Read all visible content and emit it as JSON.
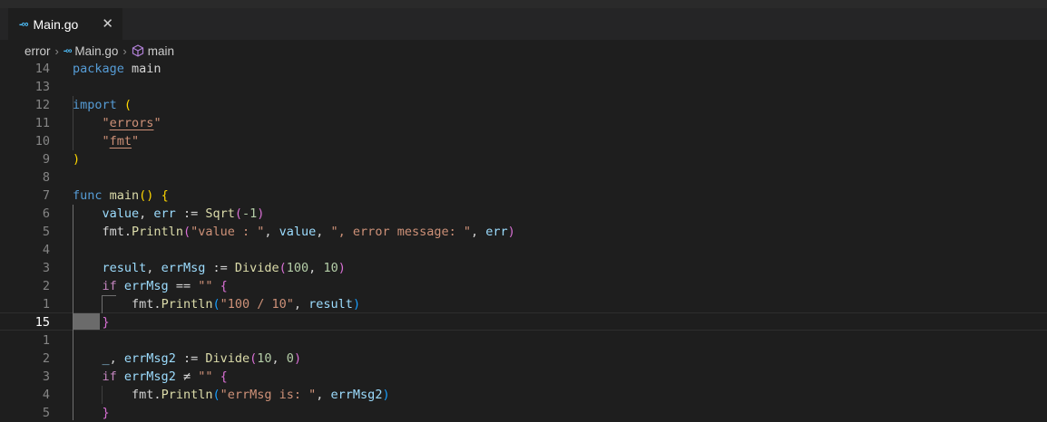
{
  "tab": {
    "icon": "go-file-icon",
    "label": "Main.go",
    "close_icon": "close-icon",
    "close_glyph": "✕"
  },
  "breadcrumb": {
    "folder": "error",
    "file": "Main.go",
    "symbol": "main",
    "sep": "›"
  },
  "editor": {
    "cursor_line_number": "15",
    "lines": [
      {
        "num": "14",
        "tokens": [
          {
            "t": "package",
            "c": "kw"
          },
          {
            "t": " main",
            "c": "pkg"
          }
        ]
      },
      {
        "num": "13",
        "tokens": []
      },
      {
        "num": "12",
        "tokens": [
          {
            "t": "import",
            "c": "kw"
          },
          {
            "t": " ",
            "c": "op"
          },
          {
            "t": "(",
            "c": "b1"
          }
        ]
      },
      {
        "num": "11",
        "tokens": [
          {
            "t": "    ",
            "c": "op"
          },
          {
            "t": "\"",
            "c": "str"
          },
          {
            "t": "errors",
            "c": "str ul"
          },
          {
            "t": "\"",
            "c": "str"
          }
        ]
      },
      {
        "num": "10",
        "tokens": [
          {
            "t": "    ",
            "c": "op"
          },
          {
            "t": "\"",
            "c": "str"
          },
          {
            "t": "fmt",
            "c": "str ul"
          },
          {
            "t": "\"",
            "c": "str"
          }
        ]
      },
      {
        "num": "9",
        "tokens": [
          {
            "t": ")",
            "c": "b1"
          }
        ]
      },
      {
        "num": "8",
        "tokens": []
      },
      {
        "num": "7",
        "tokens": [
          {
            "t": "func",
            "c": "kw"
          },
          {
            "t": " ",
            "c": "op"
          },
          {
            "t": "main",
            "c": "fn"
          },
          {
            "t": "()",
            "c": "b1"
          },
          {
            "t": " ",
            "c": "op"
          },
          {
            "t": "{",
            "c": "b1"
          }
        ]
      },
      {
        "num": "6",
        "tokens": [
          {
            "t": "    ",
            "c": "op"
          },
          {
            "t": "value",
            "c": "var"
          },
          {
            "t": ", ",
            "c": "op"
          },
          {
            "t": "err",
            "c": "var"
          },
          {
            "t": " := ",
            "c": "op"
          },
          {
            "t": "Sqrt",
            "c": "fn"
          },
          {
            "t": "(",
            "c": "b2"
          },
          {
            "t": "-1",
            "c": "num"
          },
          {
            "t": ")",
            "c": "b2"
          }
        ]
      },
      {
        "num": "5",
        "tokens": [
          {
            "t": "    ",
            "c": "op"
          },
          {
            "t": "fmt",
            "c": "pkg"
          },
          {
            "t": ".",
            "c": "op"
          },
          {
            "t": "Println",
            "c": "fn"
          },
          {
            "t": "(",
            "c": "b2"
          },
          {
            "t": "\"value : \"",
            "c": "str"
          },
          {
            "t": ", ",
            "c": "op"
          },
          {
            "t": "value",
            "c": "var"
          },
          {
            "t": ", ",
            "c": "op"
          },
          {
            "t": "\", error message: \"",
            "c": "str"
          },
          {
            "t": ", ",
            "c": "op"
          },
          {
            "t": "err",
            "c": "var"
          },
          {
            "t": ")",
            "c": "b2"
          }
        ]
      },
      {
        "num": "4",
        "tokens": []
      },
      {
        "num": "3",
        "tokens": [
          {
            "t": "    ",
            "c": "op"
          },
          {
            "t": "result",
            "c": "var"
          },
          {
            "t": ", ",
            "c": "op"
          },
          {
            "t": "errMsg",
            "c": "var"
          },
          {
            "t": " := ",
            "c": "op"
          },
          {
            "t": "Divide",
            "c": "fn"
          },
          {
            "t": "(",
            "c": "b2"
          },
          {
            "t": "100",
            "c": "num"
          },
          {
            "t": ", ",
            "c": "op"
          },
          {
            "t": "10",
            "c": "num"
          },
          {
            "t": ")",
            "c": "b2"
          }
        ]
      },
      {
        "num": "2",
        "tokens": [
          {
            "t": "    ",
            "c": "op"
          },
          {
            "t": "if",
            "c": "ctl"
          },
          {
            "t": " ",
            "c": "op"
          },
          {
            "t": "errMsg",
            "c": "var"
          },
          {
            "t": " == ",
            "c": "op"
          },
          {
            "t": "\"\"",
            "c": "str"
          },
          {
            "t": " ",
            "c": "op"
          },
          {
            "t": "{",
            "c": "b2"
          }
        ]
      },
      {
        "num": "1",
        "tokens": [
          {
            "t": "        ",
            "c": "op"
          },
          {
            "t": "fmt",
            "c": "pkg"
          },
          {
            "t": ".",
            "c": "op"
          },
          {
            "t": "Println",
            "c": "fn"
          },
          {
            "t": "(",
            "c": "b3"
          },
          {
            "t": "\"100 / 10\"",
            "c": "str"
          },
          {
            "t": ", ",
            "c": "op"
          },
          {
            "t": "result",
            "c": "var"
          },
          {
            "t": ")",
            "c": "b3"
          }
        ]
      },
      {
        "num": "15",
        "tokens": [
          {
            "t": "    ",
            "c": "op"
          },
          {
            "t": "}",
            "c": "b2"
          }
        ]
      },
      {
        "num": "1",
        "tokens": []
      },
      {
        "num": "2",
        "tokens": [
          {
            "t": "    ",
            "c": "op"
          },
          {
            "t": "_",
            "c": "var"
          },
          {
            "t": ", ",
            "c": "op"
          },
          {
            "t": "errMsg2",
            "c": "var"
          },
          {
            "t": " := ",
            "c": "op"
          },
          {
            "t": "Divide",
            "c": "fn"
          },
          {
            "t": "(",
            "c": "b2"
          },
          {
            "t": "10",
            "c": "num"
          },
          {
            "t": ", ",
            "c": "op"
          },
          {
            "t": "0",
            "c": "num"
          },
          {
            "t": ")",
            "c": "b2"
          }
        ]
      },
      {
        "num": "3",
        "tokens": [
          {
            "t": "    ",
            "c": "op"
          },
          {
            "t": "if",
            "c": "ctl"
          },
          {
            "t": " ",
            "c": "op"
          },
          {
            "t": "errMsg2",
            "c": "var"
          },
          {
            "t": " ≠ ",
            "c": "op"
          },
          {
            "t": "\"\"",
            "c": "str"
          },
          {
            "t": " ",
            "c": "op"
          },
          {
            "t": "{",
            "c": "b2"
          }
        ]
      },
      {
        "num": "4",
        "tokens": [
          {
            "t": "        ",
            "c": "op"
          },
          {
            "t": "fmt",
            "c": "pkg"
          },
          {
            "t": ".",
            "c": "op"
          },
          {
            "t": "Println",
            "c": "fn"
          },
          {
            "t": "(",
            "c": "b3"
          },
          {
            "t": "\"errMsg is: \"",
            "c": "str"
          },
          {
            "t": ", ",
            "c": "op"
          },
          {
            "t": "errMsg2",
            "c": "var"
          },
          {
            "t": ")",
            "c": "b3"
          }
        ]
      },
      {
        "num": "5",
        "tokens": [
          {
            "t": "    ",
            "c": "op"
          },
          {
            "t": "}",
            "c": "b2"
          }
        ]
      }
    ]
  }
}
